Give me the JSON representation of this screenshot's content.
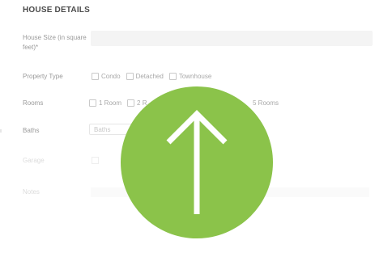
{
  "section": {
    "title": "HOUSE DETAILS"
  },
  "house_size": {
    "label": "House Size (in square feet)*",
    "value": ""
  },
  "property_type": {
    "label": "Property Type",
    "options": [
      "Condo",
      "Detached",
      "Townhouse"
    ]
  },
  "rooms": {
    "label": "Rooms",
    "options": [
      "1 Room",
      "2 R",
      "5 Rooms"
    ]
  },
  "baths": {
    "label": "Baths",
    "placeholder": "Baths"
  },
  "garage": {
    "label": "Garage"
  },
  "notes": {
    "label": "Notes"
  },
  "overlay": {
    "icon": "arrow-up-icon",
    "color": "#8bc34a"
  }
}
